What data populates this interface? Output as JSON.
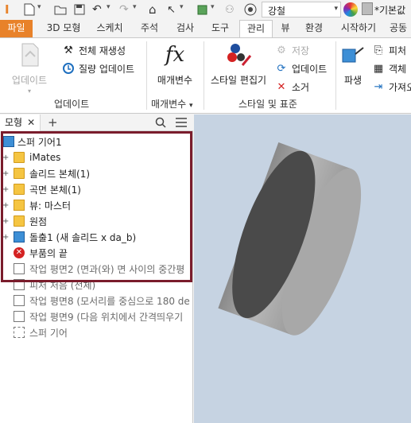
{
  "quick_access": {
    "material": "강철",
    "appearance": "*기본값"
  },
  "tabs": [
    {
      "label": "파일"
    },
    {
      "label": "3D 모형"
    },
    {
      "label": "스케치"
    },
    {
      "label": "주석"
    },
    {
      "label": "검사"
    },
    {
      "label": "도구"
    },
    {
      "label": "관리"
    },
    {
      "label": "뷰"
    },
    {
      "label": "환경"
    },
    {
      "label": "시작하기"
    },
    {
      "label": "공동"
    }
  ],
  "ribbon": {
    "update_group": {
      "label": "업데이트",
      "update_button": "업데이트",
      "rebuild_all": "전체 재생성",
      "mass_update": "질량 업데이트"
    },
    "params_group": {
      "label": "매개변수",
      "params_button": "매개변수",
      "params_icon_text": "fx"
    },
    "styles_group": {
      "label": "스타일 및 표준",
      "style_editor": "스타일 편집기",
      "save": "저장",
      "update": "업데이트",
      "purge": "소거"
    },
    "insert_group": {
      "derive": "파생",
      "feature": "피처",
      "object": "객체",
      "import": "가져오"
    }
  },
  "browser": {
    "tab_label": "모형",
    "items": [
      {
        "label": "스퍼 기어1"
      },
      {
        "label": "iMates"
      },
      {
        "label": "솔리드 본체(1)"
      },
      {
        "label": "곡면 본체(1)"
      },
      {
        "label": "뷰: 마스터"
      },
      {
        "label": "원점"
      },
      {
        "label": "돌출1 (새 솔리드 x da_b)"
      },
      {
        "label": "부품의 끝"
      },
      {
        "label": "작업 평면2 (면과(와) 면 사이의 중간평"
      },
      {
        "label": "피처 처음 (전체)"
      },
      {
        "label": "작업 평면8 (모서리를 중심으로 180 de"
      },
      {
        "label": "작업 평면9 (다음 위치에서 간격띄우기"
      },
      {
        "label": "스퍼 기어"
      }
    ]
  },
  "colors": {
    "file_tab": "#e8822a",
    "highlight_box": "#7a1c2c",
    "viewport_bg": "#c6d3e2",
    "model_face": "#4a4a4a",
    "model_side": "#9a9a9a"
  }
}
